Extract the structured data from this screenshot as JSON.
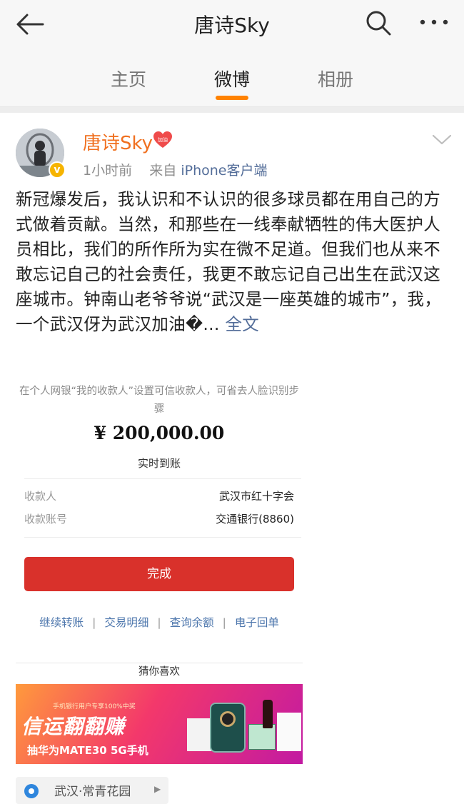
{
  "header": {
    "title": "唐诗Sky"
  },
  "tabs": [
    {
      "label": "主页"
    },
    {
      "label": "微博"
    },
    {
      "label": "相册"
    }
  ],
  "post": {
    "username": "唐诗Sky",
    "badge_text": "加油",
    "time": "1小时前",
    "source_prefix": "来自",
    "source": "iPhone客户端",
    "content": "新冠爆发后，我认识和不认识的很多球员都在用自己的方式做着贡献。当然，和那些在一线奉献牺牲的伟大医护人员相比，我们的所作所为实在微不足道。但我们也从来不敢忘记自己的社会责任，我更不敢忘记自己出生在武汉这座城市。钟南山老爷爷说“武汉是一座英雄的城市”，我，一个武汉伢为武汉加油�...",
    "more_label": "全文"
  },
  "receipt": {
    "tip": "在个人网银“我的收款人”设置可信收款人，可省去人脸识别步骤",
    "amount": "¥ 200,000.00",
    "arrival": "实时到账",
    "payee_label": "收款人",
    "payee_value": "武汉市红十字会",
    "account_label": "收款账号",
    "account_value": "交通银行(8860)",
    "done_label": "完成",
    "links": [
      "继续转账",
      "交易明细",
      "查询余额",
      "电子回单"
    ],
    "guess_label": "猜你喜欢"
  },
  "banner": {
    "small_text": "手机银行用户专享100%中奖",
    "headline": "信运翻翻赚",
    "subline": "抽华为MATE30 5G手机"
  },
  "location": {
    "label": "武汉·常青花园"
  },
  "colors": {
    "accent": "#ff8200",
    "username": "#f07020",
    "link": "#536d99",
    "done_button": "#d9312b"
  }
}
